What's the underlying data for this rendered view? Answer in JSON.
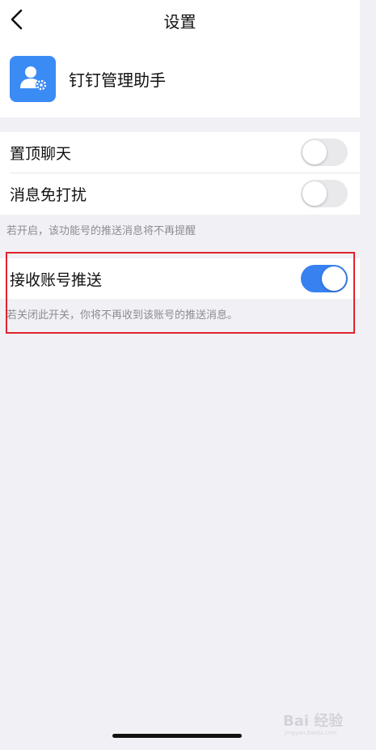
{
  "header": {
    "title": "设置",
    "back_icon": "chevron-left-icon"
  },
  "account": {
    "name": "钉钉管理助手",
    "avatar_icon": "user-gear-icon",
    "avatar_color": "#3b8bf5"
  },
  "settings": {
    "pin_chat": {
      "label": "置顶聊天",
      "enabled": false
    },
    "mute": {
      "label": "消息免打扰",
      "enabled": false
    },
    "mute_hint": "若开启，该功能号的推送消息将不再提醒",
    "receive_push": {
      "label": "接收账号推送",
      "enabled": true
    },
    "receive_push_hint": "若关闭此开关，你将不再收到该账号的推送消息。"
  },
  "watermark": {
    "text": "Bai 经验",
    "sub": "jingyan.baidu.com"
  },
  "colors": {
    "toggle_on": "#3781f0",
    "toggle_off": "#e9e9ec",
    "highlight": "#e0232b",
    "background": "#f1f1f5"
  }
}
